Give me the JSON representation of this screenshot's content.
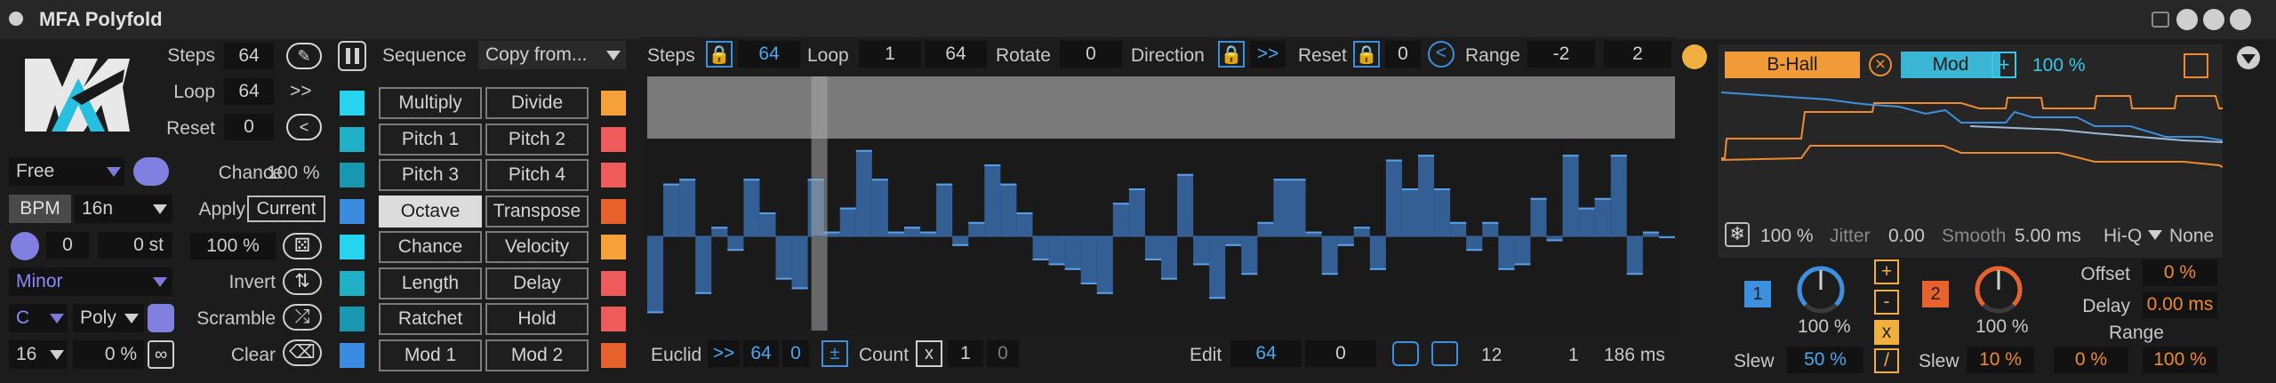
{
  "titlebar": {
    "title": "MFA Polyfold"
  },
  "left": {
    "steps_label": "Steps",
    "steps_value": "64",
    "loop_label": "Loop",
    "loop_value": "64",
    "loop_button": ">>",
    "reset_label": "Reset",
    "reset_value": "0",
    "reset_button": "<",
    "mode_select": "Free",
    "bpm_label": "BPM",
    "division_select": "16n",
    "transpose_value": "0",
    "semitone_value": "0 st",
    "scale_select": "Minor",
    "key_select": "C",
    "voice_select": "Poly",
    "octave_select": "16",
    "percent_value": "0 %"
  },
  "mid": {
    "chance_label": "Chance",
    "chance_value": "100 %",
    "apply_label": "Apply",
    "apply_value": "Current",
    "amount_value": "100 %",
    "invert_label": "Invert",
    "scramble_label": "Scramble",
    "clear_label": "Clear"
  },
  "sequence": {
    "label": "Sequence",
    "copy_select": "Copy from...",
    "buttons": [
      [
        "Multiply",
        "Divide"
      ],
      [
        "Pitch 1",
        "Pitch 2"
      ],
      [
        "Pitch 3",
        "Pitch 4"
      ],
      [
        "Octave",
        "Transpose"
      ],
      [
        "Chance",
        "Velocity"
      ],
      [
        "Length",
        "Delay"
      ],
      [
        "Ratchet",
        "Hold"
      ],
      [
        "Mod 1",
        "Mod 2"
      ]
    ],
    "left_colors": [
      "#27d4ef",
      "#1fb0c8",
      "#1797b0",
      "#3b8ce0",
      "#27d4ef",
      "#1fb0c8",
      "#1797b0",
      "#3b8ce0"
    ],
    "right_colors": [
      "#f6a13a",
      "#ef5a5a",
      "#ef5a5a",
      "#e8622e",
      "#f6a13a",
      "#ef5a5a",
      "#ef5a5a",
      "#e8622e"
    ]
  },
  "editor": {
    "steps_label": "Steps",
    "steps_value": "64",
    "loop_label": "Loop",
    "loop_start": "1",
    "loop_end": "64",
    "rotate_label": "Rotate",
    "rotate_value": "0",
    "direction_label": "Direction",
    "direction_value": ">>",
    "reset_label": "Reset",
    "reset_value": "0",
    "range_label": "Range",
    "range_min": "-2",
    "range_max": "2",
    "euclid_label": "Euclid",
    "euclid_dir": ">>",
    "euclid_steps": "64",
    "euclid_offset": "0",
    "count_label": "Count",
    "count_x": "x",
    "count_value": "1",
    "count_value2": "0",
    "edit_label": "Edit",
    "edit_step": "64",
    "edit_value": "0",
    "status_a": "12",
    "status_b": "1",
    "status_time": "186 ms",
    "playhead_step": 10,
    "bars": [
      -1.6,
      1.1,
      1.2,
      -1.2,
      0.2,
      -0.3,
      1.2,
      0.5,
      -0.9,
      -1.1,
      1.2,
      0.1,
      0.6,
      1.8,
      1.2,
      0.1,
      0.2,
      0.1,
      1.1,
      -0.2,
      0.3,
      1.5,
      1.1,
      0.5,
      -0.5,
      -0.6,
      -0.7,
      -1.0,
      -1.2,
      0.7,
      1.0,
      -0.5,
      -0.9,
      1.3,
      -0.6,
      -1.3,
      -0.2,
      -0.8,
      0.3,
      1.2,
      1.2,
      0.1,
      -0.8,
      -0.2,
      0.2,
      -0.7,
      1.6,
      1.0,
      1.7,
      1.0,
      0.3,
      -0.3,
      0.3,
      -0.7,
      -0.6,
      0.8,
      -0.1,
      1.7,
      0.6,
      0.8,
      1.7,
      -0.8,
      0.1,
      0.0
    ]
  },
  "mod": {
    "preset_a": "B-Hall",
    "preset_b": "Mod",
    "plus": "+",
    "amount": "100 %",
    "percent": "100 %",
    "jitter_label": "Jitter",
    "jitter_value": "0.00",
    "smooth_label": "Smooth",
    "smooth_value": "5.00 ms",
    "filter_select": "Hi-Q",
    "filter_mode": "None",
    "ch1": "1",
    "ch1_amount": "100 %",
    "ch2": "2",
    "ch2_amount": "100 %",
    "slew1_label": "Slew",
    "slew1_value": "50 %",
    "slew2_label": "Slew",
    "slew2_value": "10 %",
    "offset_label": "Offset",
    "offset_value": "0 %",
    "delay_label": "Delay",
    "delay_value": "0.00 ms",
    "range_label": "Range",
    "range_min": "0 %",
    "range_max": "100 %",
    "op_plus": "+",
    "op_minus": "-",
    "op_mul": "x",
    "op_div": "/",
    "colors": {
      "blue": "#3d8fe0",
      "orange": "#f08a30",
      "cyan": "#39c8e8"
    }
  }
}
